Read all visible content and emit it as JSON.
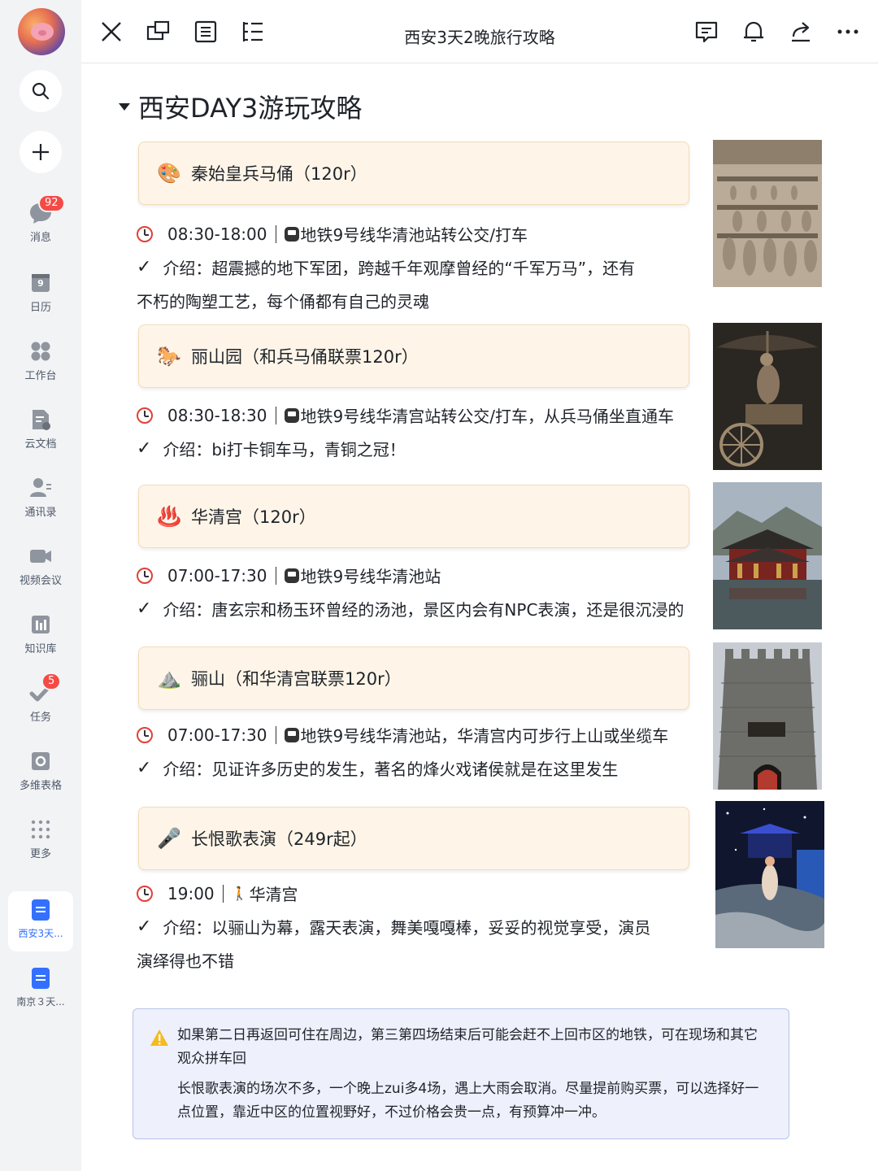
{
  "sidebar": {
    "badges": {
      "messages": "92",
      "tasks": "5"
    },
    "items": [
      {
        "label": "消息",
        "icon": "chat-bubble-icon"
      },
      {
        "label": "日历",
        "icon": "calendar-icon",
        "day": "9"
      },
      {
        "label": "工作台",
        "icon": "grid-icon"
      },
      {
        "label": "云文档",
        "icon": "cloud-doc-icon"
      },
      {
        "label": "通讯录",
        "icon": "contacts-icon"
      },
      {
        "label": "视频会议",
        "icon": "video-icon"
      },
      {
        "label": "知识库",
        "icon": "wiki-icon"
      },
      {
        "label": "任务",
        "icon": "task-icon"
      },
      {
        "label": "多维表格",
        "icon": "base-icon"
      },
      {
        "label": "更多",
        "icon": "more-dots-icon"
      }
    ],
    "docs": [
      {
        "label": "西安3天...",
        "active": true
      },
      {
        "label": "南京３天...",
        "active": false
      }
    ]
  },
  "header": {
    "title": "西安3天2晚旅行攻略"
  },
  "content": {
    "heading": "西安DAY3游玩攻略",
    "spots": [
      {
        "emoji": "🎨",
        "name": "秦始皇兵马俑（120r）",
        "time": "08:30-18:00",
        "transport": "地铁9号线华清池站转公交/打车",
        "intro_line1": "介绍：超震撼的地下军团，跨越千年观摩曾经的“千军万马”，还有",
        "intro_line2": "不朽的陶塑工艺，每个俑都有自己的灵魂"
      },
      {
        "emoji": "🐎",
        "name": "丽山园（和兵马俑联票120r）",
        "time": "08:30-18:30",
        "transport": "地铁9号线华清宫站转公交/打车，从兵马俑坐直通车",
        "intro_line1": "介绍：bi打卡铜车马，青铜之冠！",
        "intro_line2": ""
      },
      {
        "emoji": "♨️",
        "name": "华清宫（120r）",
        "time": "07:00-17:30",
        "transport": "地铁9号线华清池站",
        "intro_line1": "介绍：唐玄宗和杨玉环曾经的汤池，景区内会有NPC表演，还是很沉浸的",
        "intro_line2": ""
      },
      {
        "emoji": "⛰️",
        "name": "骊山（和华清宫联票120r）",
        "time": "07:00-17:30",
        "transport": "地铁9号线华清池站，华清宫内可步行上山或坐缆车",
        "intro_line1": "介绍：见证许多历史的发生，著名的烽火戏诸侯就是在这里发生",
        "intro_line2": ""
      },
      {
        "emoji": "🎤",
        "name": "长恨歌表演（249r起）",
        "time": "19:00",
        "transport": "华清宫",
        "intro_line1": "介绍：以骊山为幕，露天表演，舞美嘎嘎棒，妥妥的视觉享受，演员",
        "intro_line2": "演绎得也不错"
      }
    ],
    "tip": {
      "para1": "如果第二日再返回可住在周边，第三第四场结束后可能会赶不上回市区的地铁，可在现场和其它观众拼车回",
      "para2": "长恨歌表演的场次不多，一个晚上zui多4场，遇上大雨会取消。尽量提前购买票，可以选择好一点位置，靠近中区的位置视野好，不过价格会贵一点，有预算冲一冲。"
    }
  },
  "colors": {
    "accent": "#3370ff",
    "callout_bg": "#fef5e8",
    "tip_bg": "#eef0fb",
    "badge": "#f54a45"
  }
}
